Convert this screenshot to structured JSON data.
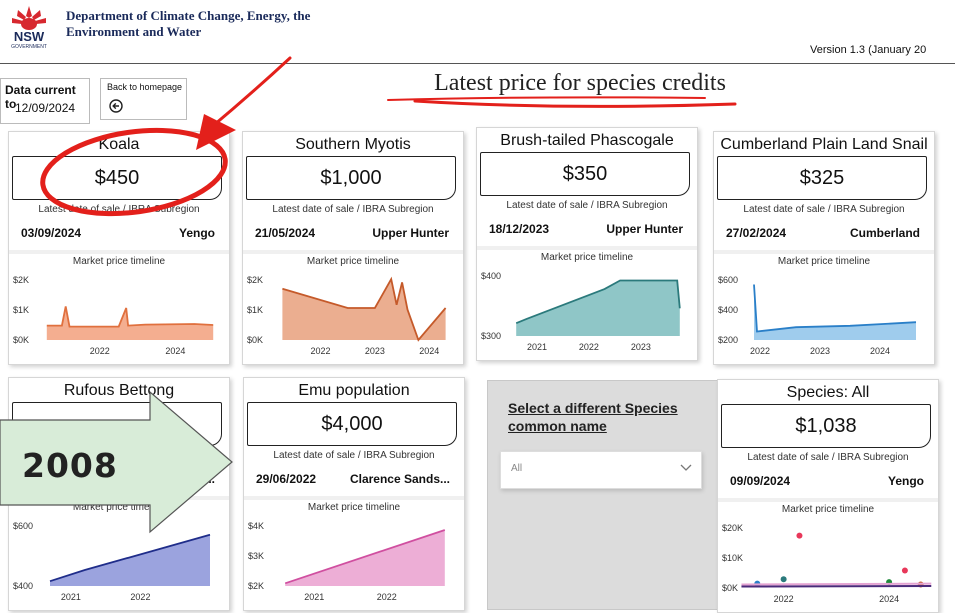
{
  "header": {
    "org_lines": [
      "Department of Climate Change, Energy, the",
      "Environment and Water"
    ],
    "logo_text": [
      "NSW",
      "GOVERNMENT"
    ],
    "version": "Version 1.3 (January 20"
  },
  "data_current": {
    "label": "Data current to",
    "value": "12/09/2024"
  },
  "back": {
    "label": "Back to homepage",
    "icon": "arrow-left-circle-icon"
  },
  "page_title": "Latest price for species credits",
  "card_labels": {
    "sale_label": "Latest date of sale / IBRA Subregion",
    "timeline_label": "Market price timeline"
  },
  "cards": [
    {
      "name": "Koala",
      "price": "$450",
      "sale_date": "03/09/2024",
      "region": "Yengo",
      "color": "#f2a07d",
      "line": "#e0703e",
      "chart_data": {
        "type": "area",
        "x_ticks": [
          "2022",
          "2024"
        ],
        "y_ticks": [
          "$2K",
          "$1K",
          "$0K"
        ],
        "ylim": [
          0,
          2000
        ],
        "points": [
          [
            2020.6,
            450
          ],
          [
            2021.0,
            450
          ],
          [
            2021.1,
            1050
          ],
          [
            2021.2,
            420
          ],
          [
            2022.5,
            420
          ],
          [
            2022.7,
            1000
          ],
          [
            2022.75,
            450
          ],
          [
            2023.2,
            480
          ],
          [
            2024.5,
            500
          ],
          [
            2025.0,
            470
          ]
        ]
      }
    },
    {
      "name": "Southern Myotis",
      "price": "$1,000",
      "sale_date": "21/05/2024",
      "region": "Upper Hunter",
      "color": "#e8a07d",
      "line": "#c55a2a",
      "chart_data": {
        "type": "area",
        "x_ticks": [
          "2022",
          "2023",
          "2024"
        ],
        "y_ticks": [
          "$2K",
          "$1K",
          "$0K"
        ],
        "ylim": [
          0,
          2000
        ],
        "points": [
          [
            2021.3,
            1600
          ],
          [
            2022.5,
            1000
          ],
          [
            2023.0,
            1000
          ],
          [
            2023.3,
            1900
          ],
          [
            2023.4,
            1100
          ],
          [
            2023.5,
            1800
          ],
          [
            2023.6,
            950
          ],
          [
            2023.8,
            0
          ],
          [
            2024.3,
            1000
          ]
        ]
      }
    },
    {
      "name": "Brush-tailed Phascogale",
      "price": "$350",
      "sale_date": "18/12/2023",
      "region": "Upper Hunter",
      "color": "#7bbcbd",
      "line": "#2b7a7c",
      "chart_data": {
        "type": "area",
        "x_ticks": [
          "2021",
          "2022",
          "2023"
        ],
        "y_ticks": [
          "$400",
          "$300"
        ],
        "ylim": [
          290,
          440
        ],
        "points": [
          [
            2020.6,
            320
          ],
          [
            2020.8,
            330
          ],
          [
            2022.3,
            400
          ],
          [
            2022.6,
            420
          ],
          [
            2023.7,
            420
          ],
          [
            2023.75,
            355
          ]
        ]
      }
    },
    {
      "name": "Cumberland Plain Land Snail",
      "price": "$325",
      "sale_date": "27/02/2024",
      "region": "Cumberland",
      "color": "#8ec3ea",
      "line": "#2a7fc8",
      "chart_data": {
        "type": "area",
        "x_ticks": [
          "2022",
          "2023",
          "2024"
        ],
        "y_ticks": [
          "$600",
          "$400",
          "$200"
        ],
        "ylim": [
          200,
          650
        ],
        "points": [
          [
            2021.9,
            590
          ],
          [
            2021.95,
            260
          ],
          [
            2022.6,
            290
          ],
          [
            2023.5,
            300
          ],
          [
            2024.6,
            325
          ]
        ]
      }
    },
    {
      "name": "Rufous Bettong",
      "price": "",
      "sale_date": "",
      "region": "s...",
      "color": "#8a93d8",
      "line": "#1f2d8a",
      "chart_data": {
        "type": "area",
        "x_ticks": [
          "2021",
          "2022"
        ],
        "y_ticks": [
          "$600",
          "$400"
        ],
        "ylim": [
          300,
          700
        ],
        "points": [
          [
            2020.7,
            330
          ],
          [
            2021.2,
            400
          ],
          [
            2023.0,
            620
          ]
        ]
      }
    },
    {
      "name": "Emu population",
      "price": "$4,000",
      "sale_date": "29/06/2022",
      "region": "Clarence Sands...",
      "color": "#eaa0cf",
      "line": "#d04fa0",
      "chart_data": {
        "type": "area",
        "x_ticks": [
          "2021",
          "2022"
        ],
        "y_ticks": [
          "$4K",
          "$3K",
          "$2K"
        ],
        "ylim": [
          1900,
          4300
        ],
        "points": [
          [
            2020.6,
            2000
          ],
          [
            2022.8,
            4000
          ]
        ]
      }
    },
    {
      "name": "Species: All",
      "price": "$1,038",
      "sale_date": "09/09/2024",
      "region": "Yengo",
      "color": "#e4a3d2",
      "line": "#4a2a7a",
      "chart_data": {
        "type": "scatter",
        "x_ticks": [
          "2022",
          "2024"
        ],
        "y_ticks": [
          "$20K",
          "$10K",
          "$0K"
        ],
        "ylim": [
          0,
          22000
        ],
        "points": [
          [
            2022.3,
            18000
          ],
          [
            2024.3,
            6000
          ],
          [
            2021.5,
            1500
          ],
          [
            2022.0,
            3000
          ],
          [
            2024.0,
            2000
          ],
          [
            2024.6,
            1200
          ]
        ]
      }
    }
  ],
  "selector": {
    "title_lines": [
      "Select a different Species",
      "common name"
    ],
    "dropdown_value": "All",
    "dropdown_icon": "chevron-down-icon"
  },
  "overlay": {
    "year": "2008",
    "colors": {
      "circle": "#e3201b",
      "arrow_fill": "#d8ecd8"
    }
  }
}
